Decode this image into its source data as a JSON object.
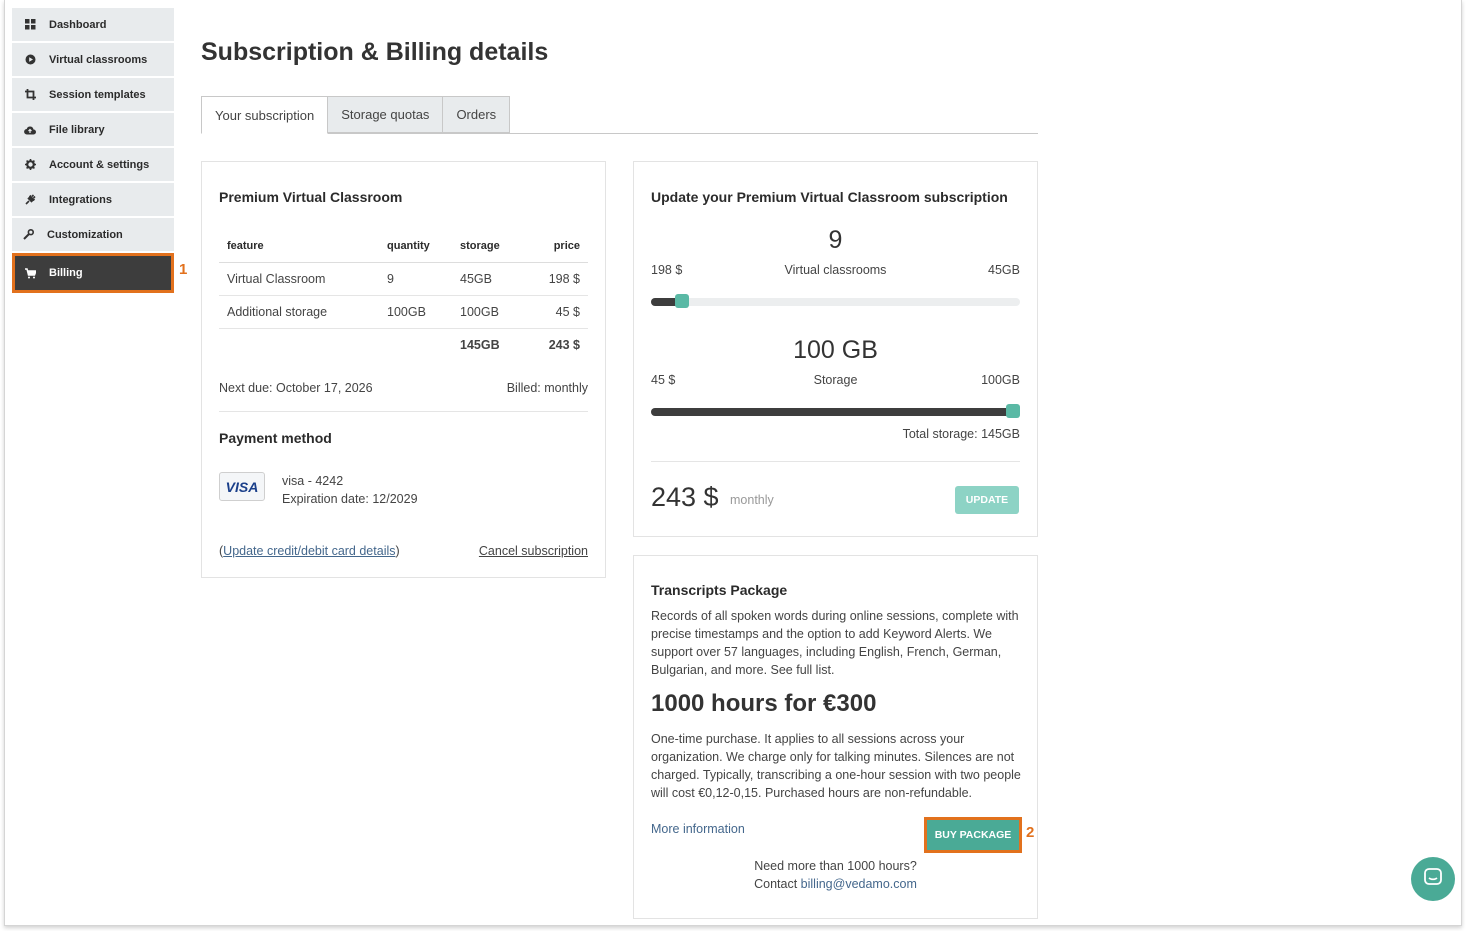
{
  "sidebar": {
    "items": [
      {
        "label": "Dashboard",
        "icon": "grid-icon"
      },
      {
        "label": "Virtual classrooms",
        "icon": "play-circle-icon"
      },
      {
        "label": "Session templates",
        "icon": "crop-icon"
      },
      {
        "label": "File library",
        "icon": "cloud-upload-icon"
      },
      {
        "label": "Account & settings",
        "icon": "gear-icon"
      },
      {
        "label": "Integrations",
        "icon": "plug-icon"
      },
      {
        "label": "Customization",
        "icon": "wrench-icon"
      },
      {
        "label": "Billing",
        "icon": "cart-icon",
        "active": true
      }
    ]
  },
  "markers": {
    "one": "1",
    "two": "2",
    "color": "#e2711d"
  },
  "page": {
    "title": "Subscription & Billing details"
  },
  "tabs": [
    "Your subscription",
    "Storage quotas",
    "Orders"
  ],
  "subscription": {
    "title": "Premium Virtual Classroom",
    "headers": {
      "feature": "feature",
      "quantity": "quantity",
      "storage": "storage",
      "price": "price"
    },
    "rows": [
      {
        "feature": "Virtual Classroom",
        "quantity": "9",
        "storage": "45GB",
        "price": "198 $"
      },
      {
        "feature": "Additional storage",
        "quantity": "100GB",
        "storage": "100GB",
        "price": "45 $"
      }
    ],
    "total": {
      "storage": "145GB",
      "price": "243 $"
    },
    "next_due": "Next due: October 17, 2026",
    "billed": "Billed: monthly",
    "payment_title": "Payment method",
    "card_brand": "VISA",
    "card_line": "visa - 4242",
    "expiration": "Expiration date: 12/2029",
    "update_card_link": "Update credit/debit card details",
    "cancel_link": "Cancel subscription"
  },
  "update": {
    "title": "Update your Premium Virtual Classroom subscription",
    "classrooms": {
      "value": "9",
      "label": "Virtual classrooms",
      "price": "198 $",
      "storage": "45GB",
      "level": 0.085
    },
    "storage": {
      "value": "100 GB",
      "label": "Storage",
      "price": "45 $",
      "storage": "100GB",
      "level": 1.0
    },
    "total_storage": "Total storage: 145GB",
    "total_price": "243 $",
    "period": "monthly",
    "button": "UPDATE"
  },
  "transcripts": {
    "title": "Transcripts Package",
    "desc": "Records of all spoken words during online sessions, complete with precise timestamps and the option to add Keyword Alerts. We support over 57 languages, including English, French, German, Bulgarian, and more. See full list.",
    "headline": "1000 hours for €300",
    "note": "One-time purchase. It applies to all sessions across your organization. We charge only for talking minutes. Silences are not charged. Typically, transcribing a one-hour session with two people will cost €0,12-0,15. Purchased hours are non-refundable.",
    "more_info": "More information",
    "button": "BUY PACKAGE",
    "need_more": "Need more than 1000 hours?",
    "contact_prefix": "Contact",
    "contact_email": "billing@vedamo.com"
  },
  "colors": {
    "accent": "#4aaa96",
    "accent_light": "#8dd3c5",
    "highlight": "#e2711d",
    "dark": "#3d3d3d"
  }
}
